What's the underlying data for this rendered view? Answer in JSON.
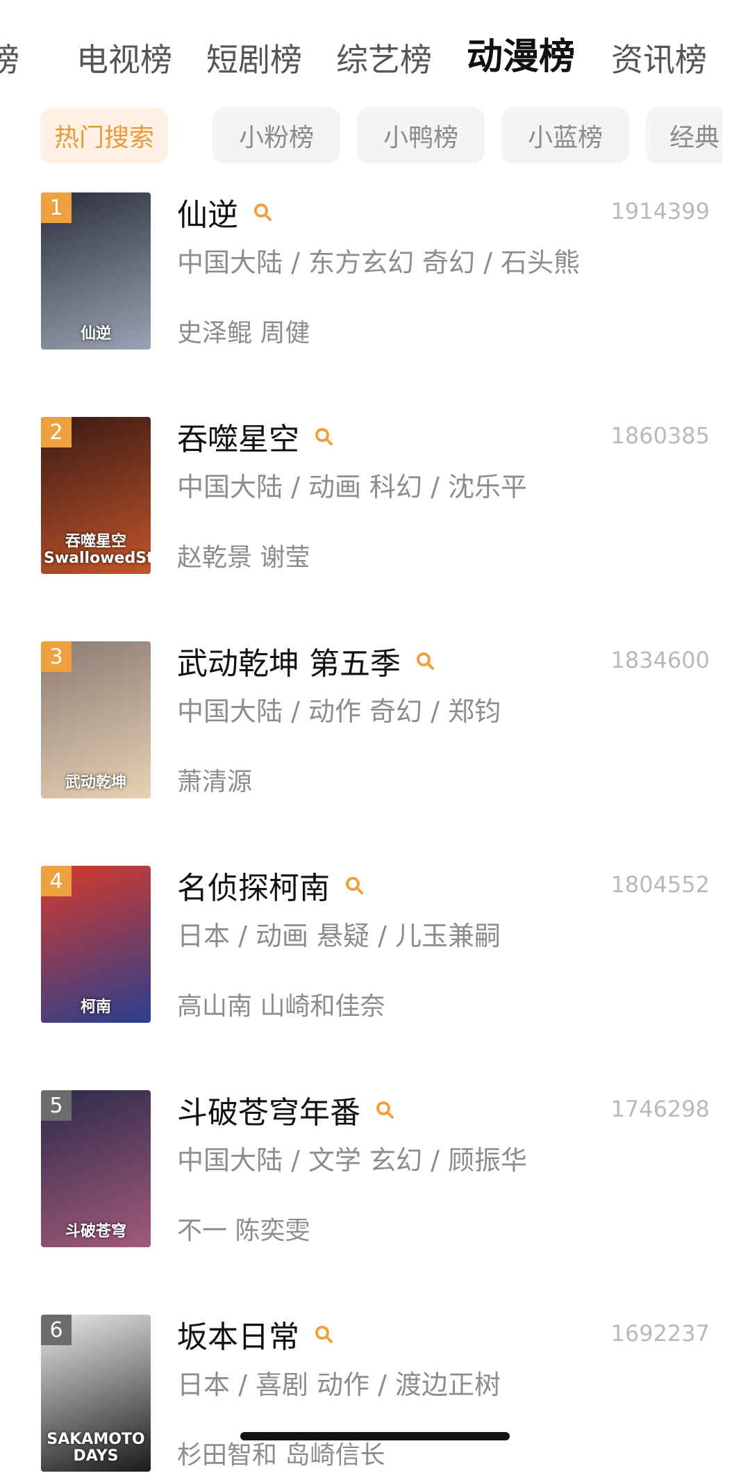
{
  "tabs": [
    {
      "label": "榜",
      "active": false
    },
    {
      "label": "电视榜",
      "active": false
    },
    {
      "label": "短剧榜",
      "active": false
    },
    {
      "label": "综艺榜",
      "active": false
    },
    {
      "label": "动漫榜",
      "active": true
    },
    {
      "label": "资讯榜",
      "active": false
    }
  ],
  "chips": [
    {
      "label": "热门搜索",
      "active": true
    },
    {
      "label": "小粉榜",
      "active": false
    },
    {
      "label": "小鸭榜",
      "active": false
    },
    {
      "label": "小蓝榜",
      "active": false
    },
    {
      "label": "经典",
      "active": false
    }
  ],
  "accent_color": "#f0a13f",
  "items": [
    {
      "rank": "1",
      "title": "仙逆",
      "count": "1914399",
      "meta": "中国大陆 / 东方玄幻 奇幻 / 石头熊",
      "cast": "史泽鲲 周健",
      "poster_text": "仙逆",
      "poster_colors": [
        "#2b2f3a",
        "#9aa3b4"
      ]
    },
    {
      "rank": "2",
      "title": "吞噬星空",
      "count": "1860385",
      "meta": "中国大陆 / 动画 科幻 / 沈乐平",
      "cast": "赵乾景 谢莹",
      "poster_text": "吞噬星空 SwallowedStar",
      "poster_colors": [
        "#3a1a14",
        "#c2552a"
      ]
    },
    {
      "rank": "3",
      "title": "武动乾坤 第五季",
      "count": "1834600",
      "meta": "中国大陆 / 动作 奇幻 / 郑钧",
      "cast": "萧清源",
      "poster_text": "武动乾坤",
      "poster_colors": [
        "#8a7a72",
        "#e8d2b4"
      ]
    },
    {
      "rank": "4",
      "title": "名侦探柯南",
      "count": "1804552",
      "meta": "日本 / 动画 悬疑 / 儿玉兼嗣",
      "cast": "高山南 山崎和佳奈",
      "poster_text": "柯南",
      "poster_colors": [
        "#d63a2a",
        "#2a3f8f"
      ]
    },
    {
      "rank": "5",
      "title": "斗破苍穹年番",
      "count": "1746298",
      "meta": "中国大陆 / 文学 玄幻 / 顾振华",
      "cast": "不一 陈奕雯",
      "poster_text": "斗破苍穹",
      "poster_colors": [
        "#2c2a4a",
        "#a35a7a"
      ]
    },
    {
      "rank": "6",
      "title": "坂本日常",
      "count": "1692237",
      "meta": "日本 / 喜剧 动作 / 渡边正树",
      "cast": "杉田智和 岛崎信长",
      "poster_text": "SAKAMOTO DAYS",
      "poster_colors": [
        "#e9e9e9",
        "#1a1a1a"
      ]
    }
  ]
}
